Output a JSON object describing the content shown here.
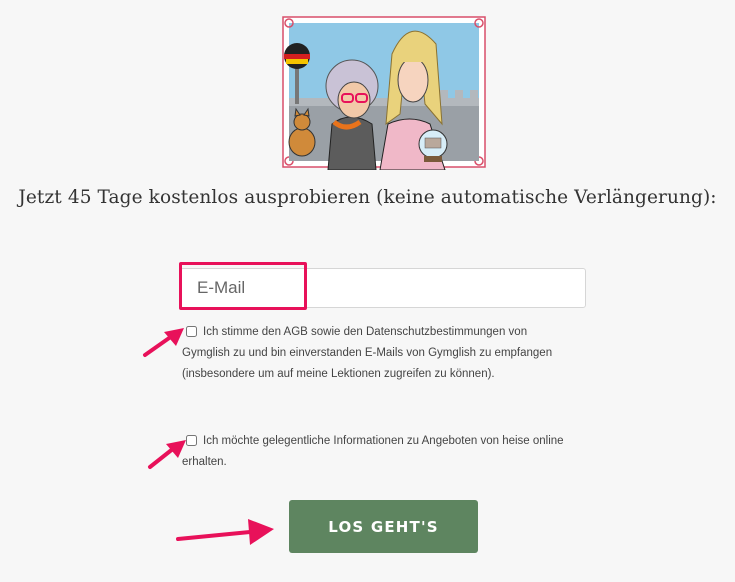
{
  "headline": "Jetzt 45 Tage kostenlos ausprobieren (keine automatische Verlängerung):",
  "email": {
    "placeholder": "E-Mail",
    "value": ""
  },
  "checkboxes": [
    {
      "text": "Ich stimme den AGB sowie den Datenschutzbestimmungen von Gymglish zu und bin einverstanden E-Mails von Gymglish zu empfangen (insbesondere um auf meine Lektionen zugreifen zu können).",
      "checked": false
    },
    {
      "text": "Ich möchte gelegentliche Informationen zu Angeboten von heise online erhalten.",
      "checked": false
    }
  ],
  "submit_label": "LOS GEHT'S",
  "colors": {
    "button": "#5e8560",
    "highlight": "#e8115a",
    "arrow": "#e8115a",
    "frame": "#d94f6a"
  },
  "icons": [
    "comic-illustration",
    "germany-flag",
    "cat",
    "snow-globe",
    "arrow-icon"
  ]
}
